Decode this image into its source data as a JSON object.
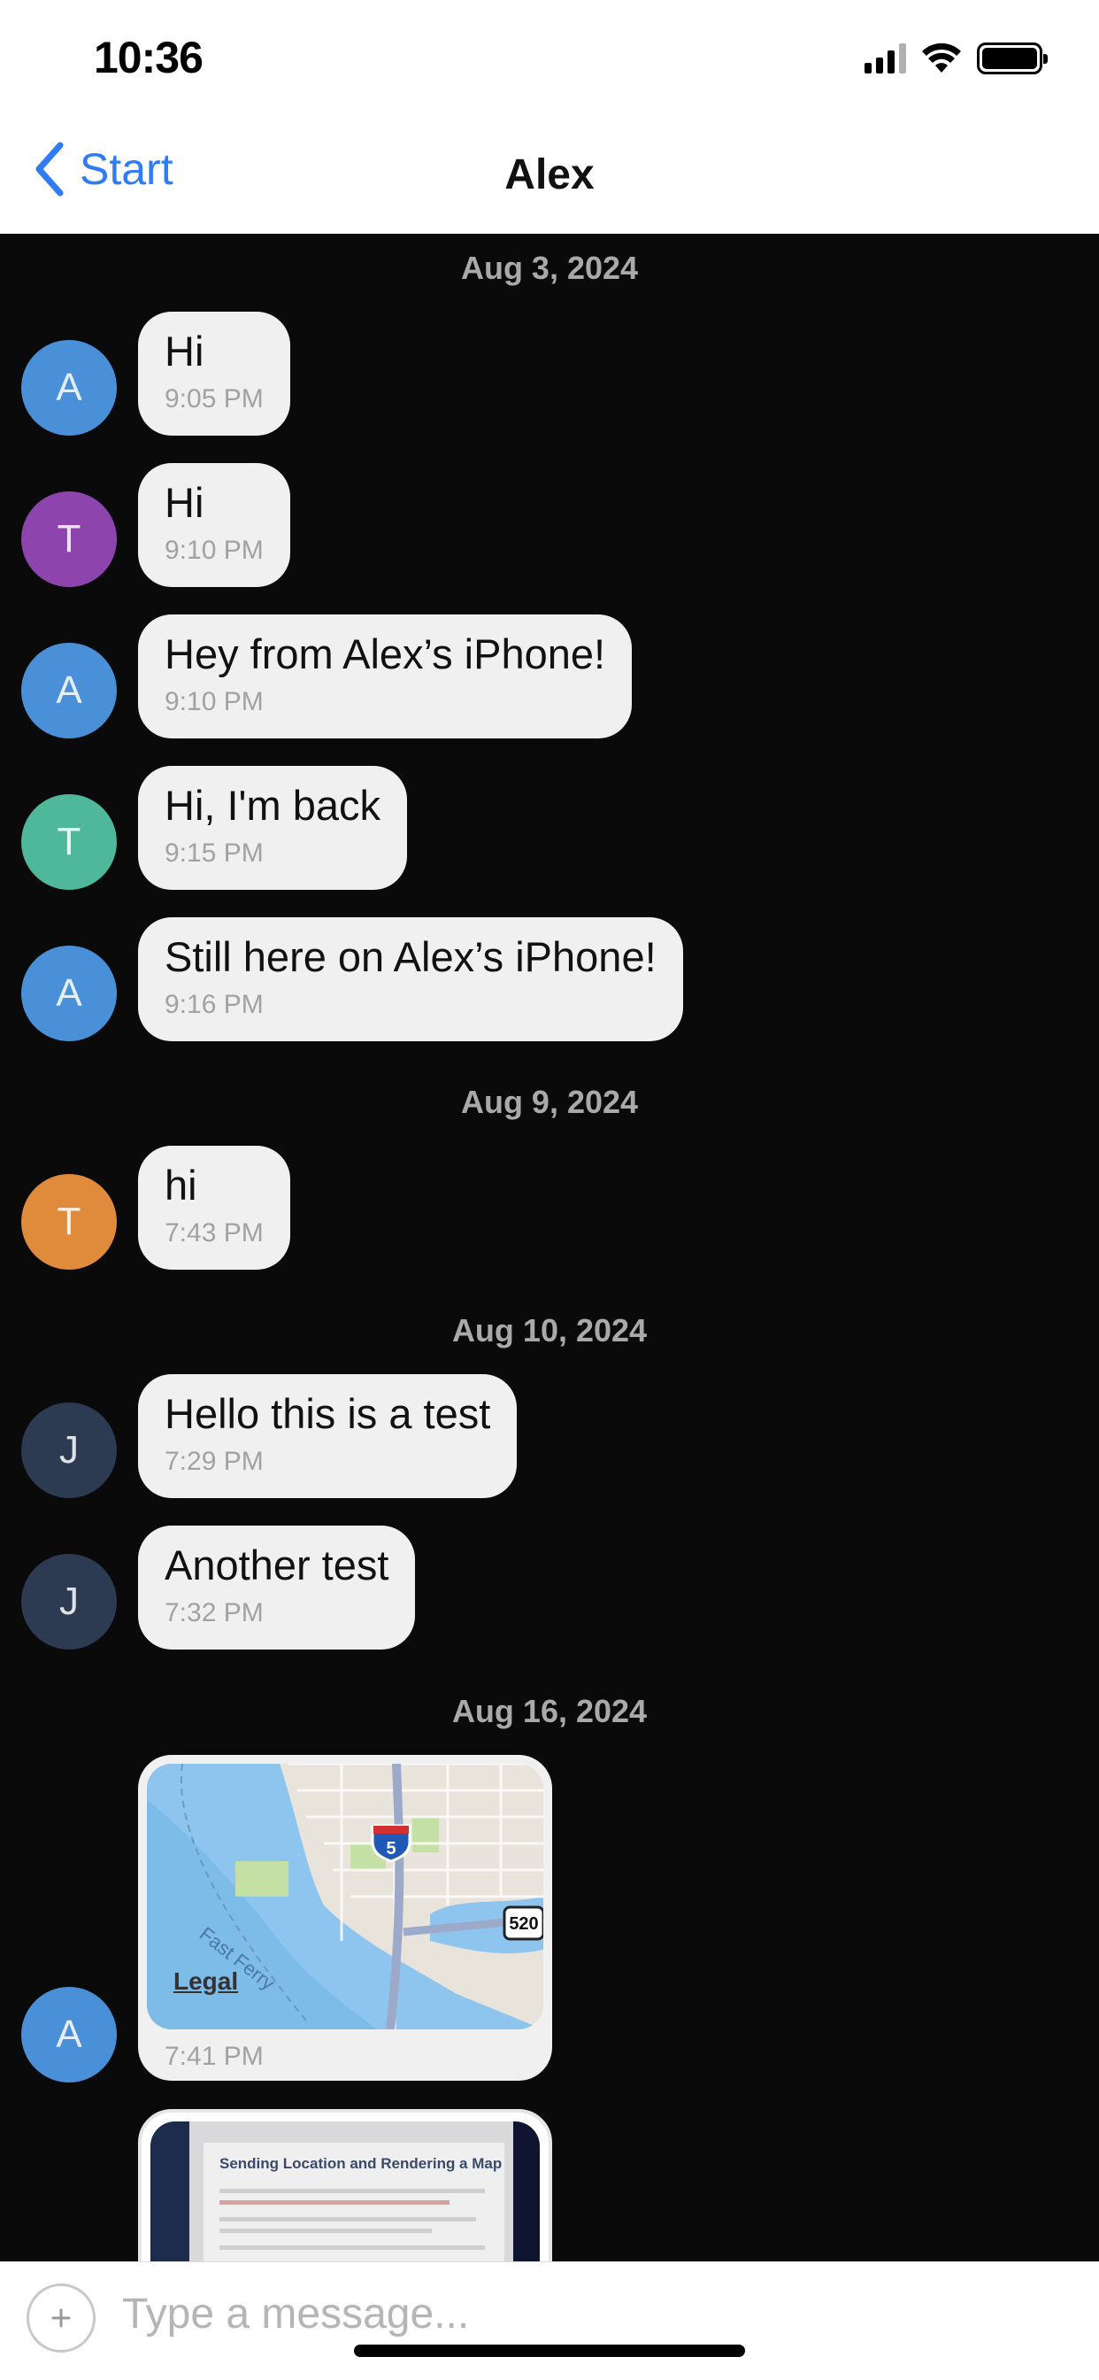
{
  "status_bar": {
    "time": "10:36",
    "signal_icon": "cellular-signal-icon",
    "wifi_icon": "wifi-icon",
    "battery_icon": "battery-icon"
  },
  "nav": {
    "back_label": "Start",
    "title": "Alex",
    "back_icon": "chevron-left-icon"
  },
  "colors": {
    "accent": "#2f7cf6",
    "chat_background": "#0a0a0a",
    "bubble": "#f0f0f0"
  },
  "groups": [
    {
      "date": "Aug 3, 2024",
      "messages": [
        {
          "initial": "A",
          "avatar_color": "#4a90d9",
          "text": "Hi",
          "time": "9:05 PM"
        },
        {
          "initial": "T",
          "avatar_color": "#8e44ad",
          "text": "Hi",
          "time": "9:10 PM"
        },
        {
          "initial": "A",
          "avatar_color": "#4a90d9",
          "text": "Hey from Alex’s iPhone!",
          "time": "9:10 PM"
        },
        {
          "initial": "T",
          "avatar_color": "#4fb89a",
          "text": "Hi, I'm back",
          "time": "9:15 PM"
        },
        {
          "initial": "A",
          "avatar_color": "#4a90d9",
          "text": "Still here on Alex’s iPhone!",
          "time": "9:16 PM"
        }
      ]
    },
    {
      "date": "Aug 9, 2024",
      "messages": [
        {
          "initial": "T",
          "avatar_color": "#e08a3c",
          "text": "hi",
          "time": "7:43 PM"
        }
      ]
    },
    {
      "date": "Aug 10, 2024",
      "messages": [
        {
          "initial": "J",
          "avatar_color": "#2c3a52",
          "text": "Hello this is a test",
          "time": "7:29 PM"
        },
        {
          "initial": "J",
          "avatar_color": "#2c3a52",
          "text": "Another test",
          "time": "7:32 PM"
        }
      ]
    },
    {
      "date": "Aug 16, 2024",
      "messages": [
        {
          "initial": "A",
          "avatar_color": "#4a90d9",
          "type": "map",
          "time": "7:41 PM",
          "map_labels": {
            "ferry": "Fast Ferry",
            "interstate": "5",
            "route": "520",
            "legal": "Legal"
          }
        },
        {
          "type": "image",
          "image_title": "Sending Location and Rendering a Map"
        }
      ]
    }
  ],
  "input": {
    "placeholder": "Type a message...",
    "attach_icon": "add-attachment-icon"
  }
}
